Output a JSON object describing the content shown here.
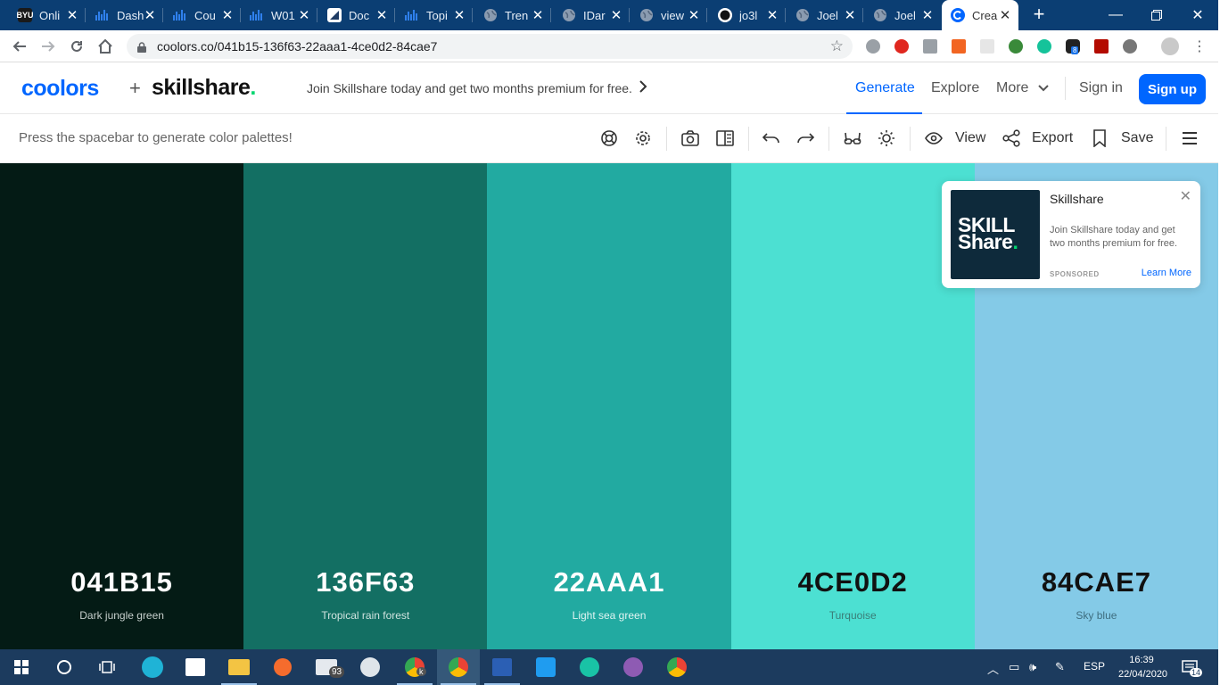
{
  "browser": {
    "tabs": [
      {
        "title": "Onli",
        "icon": "byu-icon",
        "color": "#1a1a1a"
      },
      {
        "title": "Dash",
        "icon": "bars-icon",
        "color": "#2f80ed"
      },
      {
        "title": "Cou",
        "icon": "bars-icon",
        "color": "#2f80ed"
      },
      {
        "title": "W01",
        "icon": "bars-icon",
        "color": "#2f80ed"
      },
      {
        "title": "Doc",
        "icon": "doc-icon",
        "color": "#ffffff"
      },
      {
        "title": "Topi",
        "icon": "bars-icon",
        "color": "#2f80ed"
      },
      {
        "title": "Tren",
        "icon": "globe-icon",
        "color": "#8a9bb0"
      },
      {
        "title": "IDar",
        "icon": "globe-icon",
        "color": "#8a9bb0"
      },
      {
        "title": "view",
        "icon": "globe-icon",
        "color": "#8a9bb0"
      },
      {
        "title": "jo3l",
        "icon": "github-icon",
        "color": "#ffffff"
      },
      {
        "title": "Joel",
        "icon": "globe-icon",
        "color": "#8a9bb0"
      },
      {
        "title": "Joel",
        "icon": "globe-icon",
        "color": "#8a9bb0"
      },
      {
        "title": "Crea",
        "icon": "coolors-icon",
        "color": "#0066ff"
      }
    ],
    "byu_label": "BYU",
    "url": "coolors.co/041b15-136f63-22aaa1-4ce0d2-84cae7",
    "extension_badge": "8"
  },
  "header": {
    "logo_coolors": "coolors",
    "logo_plus": "+",
    "logo_skillshare": "skillshare",
    "logo_dot": ".",
    "promo": "Join Skillshare today and get two months premium for free.",
    "nav": {
      "generate": "Generate",
      "explore": "Explore",
      "more": "More",
      "signin": "Sign in",
      "signup": "Sign up"
    }
  },
  "toolbar": {
    "hint": "Press the spacebar to generate color palettes!",
    "view": "View",
    "export": "Export",
    "save": "Save"
  },
  "palette": [
    {
      "hex": "041B15",
      "name": "Dark jungle green",
      "bg": "#041b15",
      "fg": "#ffffff",
      "sub": "#c6cfcc"
    },
    {
      "hex": "136F63",
      "name": "Tropical rain forest",
      "bg": "#136f63",
      "fg": "#ffffff",
      "sub": "#cfe3df"
    },
    {
      "hex": "22AAA1",
      "name": "Light sea green",
      "bg": "#22aaa1",
      "fg": "#ffffff",
      "sub": "#e0f4f2"
    },
    {
      "hex": "4CE0D2",
      "name": "Turquoise",
      "bg": "#4ce0d2",
      "fg": "#111111",
      "sub": "#3a7d77"
    },
    {
      "hex": "84CAE7",
      "name": "Sky blue",
      "bg": "#84cae7",
      "fg": "#111111",
      "sub": "#3f6e80"
    }
  ],
  "ad": {
    "image_line1": "SKILL",
    "image_line2": "Share",
    "image_dot": ".",
    "title": "Skillshare",
    "text": "Join Skillshare today and get two months premium for free.",
    "sponsored": "SPONSORED",
    "learn_more": "Learn More"
  },
  "taskbar": {
    "mail_badge": "93",
    "chrome_profile_badge": "k",
    "language": "ESP",
    "time": "16:39",
    "date": "22/04/2020",
    "notifications": "14"
  }
}
